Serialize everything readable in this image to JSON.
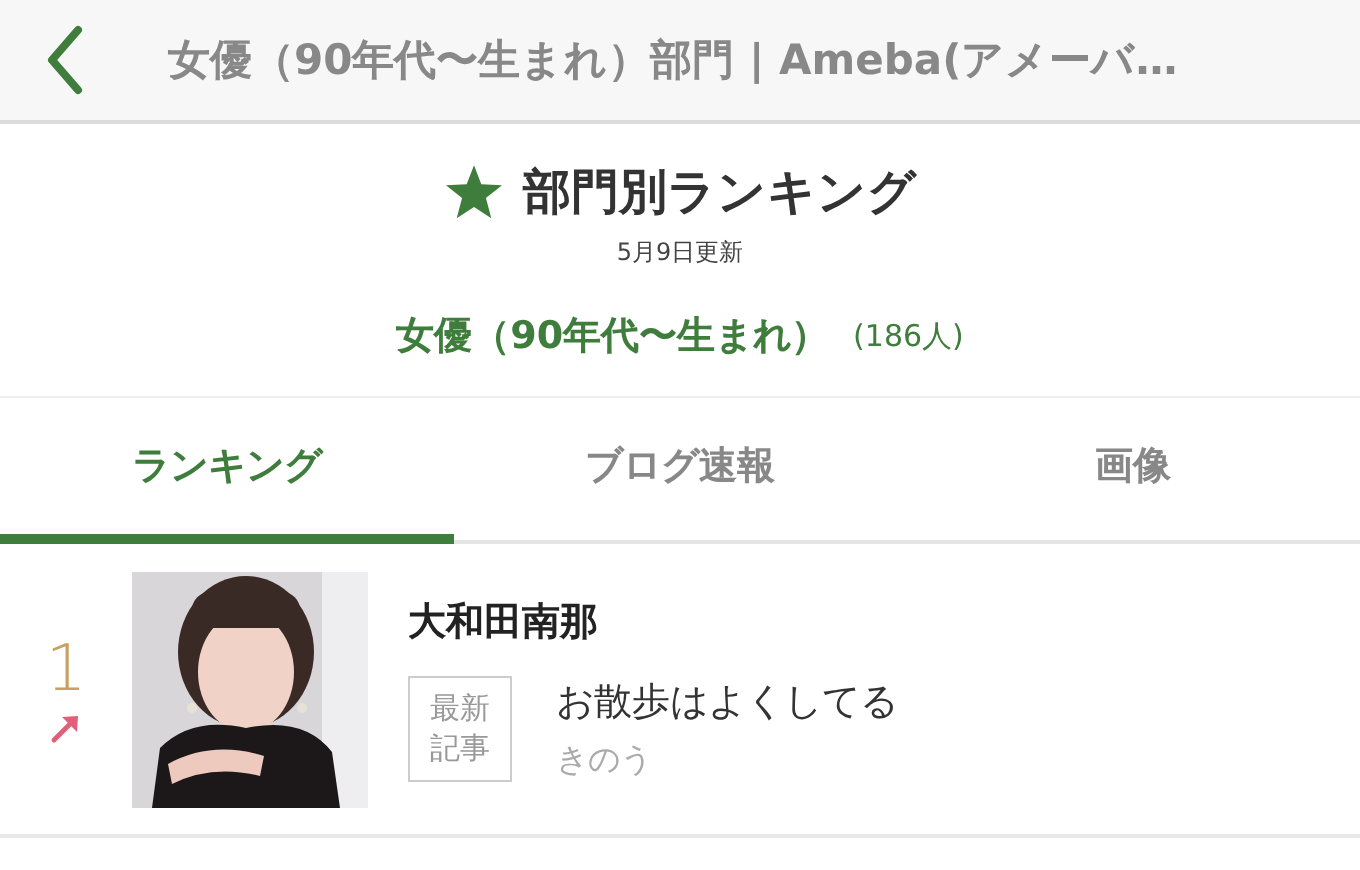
{
  "header": {
    "title": "女優（90年代〜生まれ）部門 | Ameba(アメーバ…"
  },
  "ranking_heading": {
    "title": "部門別ランキング",
    "updated": "5月9日更新"
  },
  "category": {
    "name": "女優（90年代〜生まれ）",
    "count": "(186人)"
  },
  "tabs": [
    {
      "label": "ランキング",
      "selected": true
    },
    {
      "label": "ブログ速報",
      "selected": false
    },
    {
      "label": "画像",
      "selected": false
    }
  ],
  "entries": [
    {
      "rank": "1",
      "rising": true,
      "photo": {
        "kind": "picture"
      },
      "name": "大和田南那",
      "badge_lines": [
        "最新",
        "記事"
      ],
      "post_title": "お散歩はよくしてる",
      "post_time": "きのう"
    }
  ]
}
